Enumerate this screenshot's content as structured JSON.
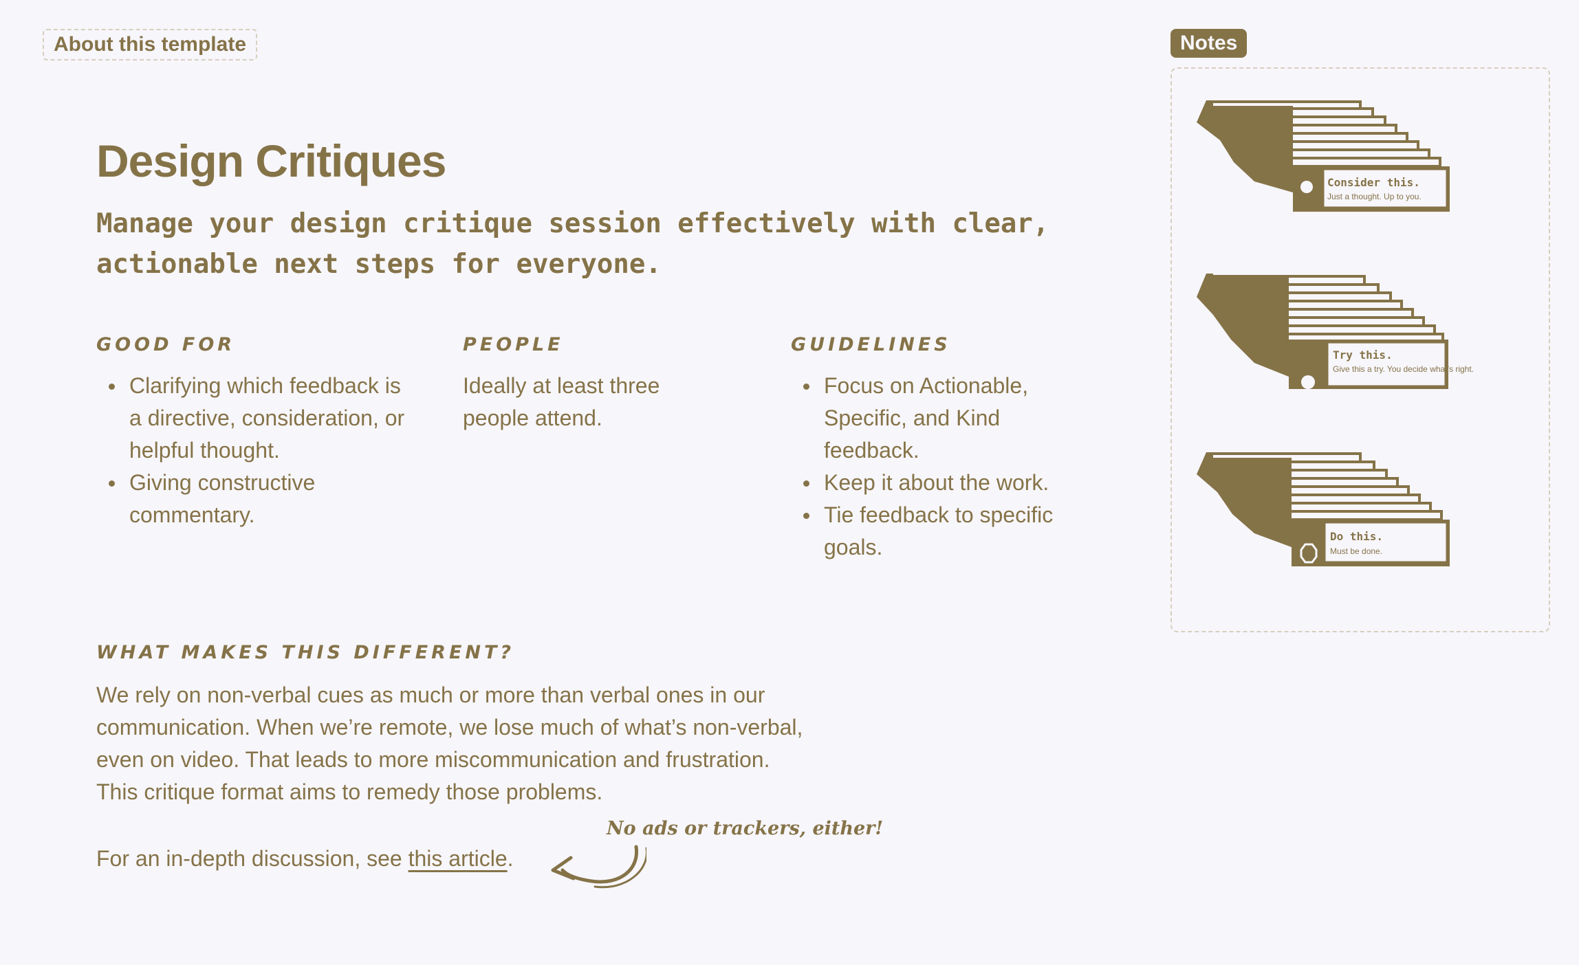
{
  "about_tab": "About this template",
  "title": "Design Critiques",
  "subtitle": "Manage your design critique session effectively with clear, actionable next steps for everyone.",
  "good_for": {
    "label": "GOOD FOR",
    "items": [
      "Clarifying which feedback is a directive, consideration, or helpful thought.",
      "Giving constructive commentary."
    ]
  },
  "people": {
    "label": "PEOPLE",
    "text": "Ideally at least three people attend."
  },
  "guidelines": {
    "label": "GUIDELINES",
    "items": [
      "Focus on Actionable, Specific, and Kind feedback.",
      "Keep it about the work.",
      "Tie feedback to specific goals."
    ]
  },
  "different": {
    "label": "WHAT MAKES THIS DIFFERENT?",
    "paragraph": "We rely on non-verbal cues as much or more than verbal ones in our communication. When we’re remote, we lose much of what’s non-verbal, even on video. That leads to more miscommunication and frustration. This critique format aims to remedy those problems.",
    "article_prefix": "For an in-depth discussion, see ",
    "article_link": "this article",
    "article_suffix": "."
  },
  "handwritten_note": "No ads or trackers, either!",
  "notes": {
    "badge": "Notes",
    "cards": [
      {
        "title": "Consider this.",
        "subtitle": "Just a thought. Up to you.",
        "icon": "skull-icon"
      },
      {
        "title": "Try this.",
        "subtitle": "Give this a try. You decide what’s right.",
        "icon": "dot-icon"
      },
      {
        "title": "Do this.",
        "subtitle": "Must be done.",
        "icon": "octagon-icon"
      }
    ]
  },
  "colors": {
    "accent": "#857348",
    "background": "#f7f6fb"
  }
}
